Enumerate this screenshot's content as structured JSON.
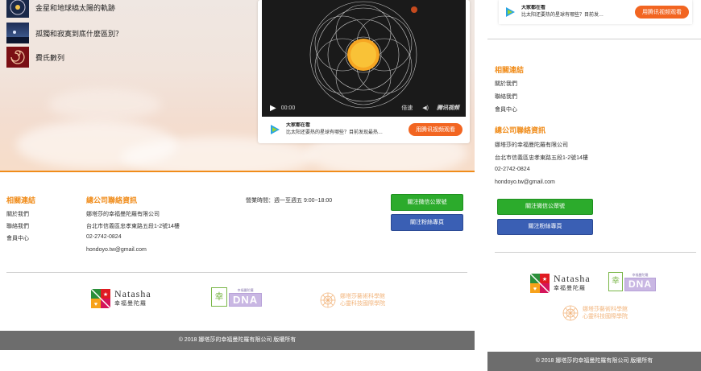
{
  "articles": [
    {
      "title": "金星和地球繞太陽的軌跡"
    },
    {
      "title": "孤獨和寂寞到底什麼區別？"
    },
    {
      "title": "費氏數列"
    }
  ],
  "video": {
    "time": "00:00",
    "speed_label": "倍速",
    "brand": "腾讯视频",
    "card_title": "大家都在看",
    "card_desc": "比太阳还要热的星球有哪些？目前发现最热…",
    "card_desc_mobile": "比太阳还要热的星球有哪些？目前发…",
    "watch_button": "用腾讯视频观看"
  },
  "footer": {
    "links_heading": "相關連結",
    "links": [
      "關於我們",
      "聯絡我們",
      "會員中心"
    ],
    "contact_heading": "總公司聯絡資訊",
    "company": "娜塔莎的幸福曼陀羅有限公司",
    "address": "台北市信義區忠孝東路五段1-2號14樓",
    "phone": "02-2742-0824",
    "email": "hondoyo.tw@gmail.com",
    "hours": "營業時間：週一至週五 9:00~18:00",
    "wechat_button": "關注微信公眾號",
    "fans_button": "關注粉絲專頁",
    "copyright": "© 2018 娜塔莎的幸福曼陀羅有限公司 版權所有"
  },
  "logos": {
    "natasha_en": "Natasha",
    "natasha_zh": "幸福曼陀羅",
    "dna_sub": "幸福曼陀羅",
    "dna_text": "DNA",
    "school_line1": "娜塔莎藝術科學館",
    "school_line2": "心靈科技國際學院"
  },
  "colors": {
    "accent_orange": "#f08c1a",
    "wechat_green": "#2cab2c",
    "facebook_blue": "#3a5fb4",
    "copyright_bg": "#6d6d6d",
    "video_button": "#f26521"
  }
}
